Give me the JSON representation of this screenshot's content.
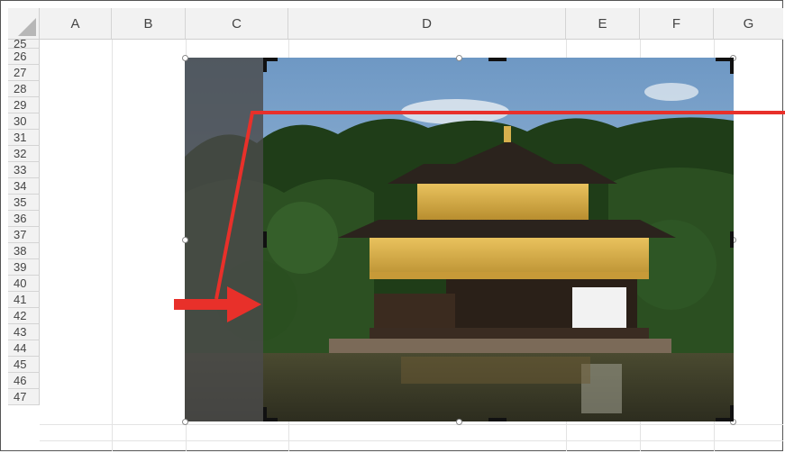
{
  "sheet": {
    "columns": [
      "A",
      "B",
      "C",
      "D",
      "E",
      "F",
      "G"
    ],
    "rows": [
      "25",
      "26",
      "27",
      "28",
      "29",
      "30",
      "31",
      "32",
      "33",
      "34",
      "35",
      "36",
      "37",
      "38",
      "39",
      "40",
      "41",
      "42",
      "43",
      "44",
      "45",
      "46",
      "47"
    ]
  },
  "picture": {
    "subject": "Golden pavilion temple photo with crop handles",
    "cropped_region_shading": "#4a4a4a"
  },
  "annotation": {
    "arrow_color": "#e8302a"
  }
}
